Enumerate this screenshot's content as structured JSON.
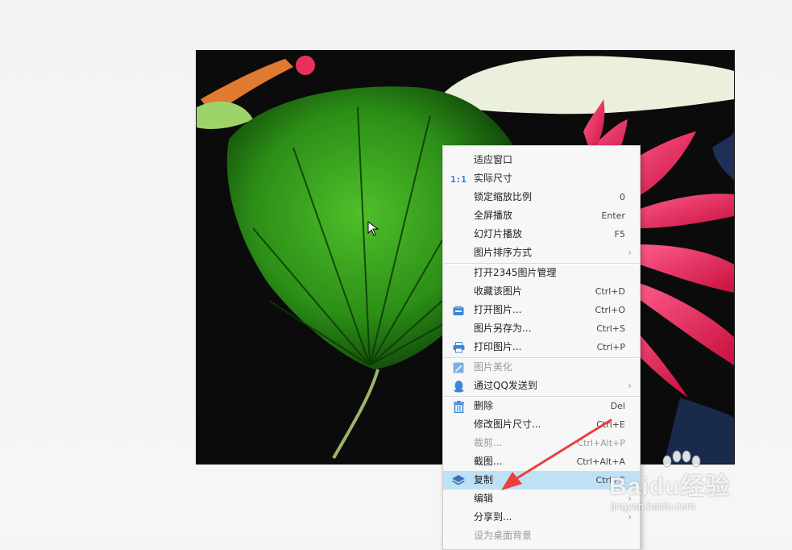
{
  "menu": {
    "items": [
      {
        "label": "适应窗口",
        "shortcut": "",
        "icon": "",
        "submenu": false,
        "disabled": false
      },
      {
        "label": "实际尺寸",
        "shortcut": "",
        "icon": "actual-size-icon",
        "icon_text": "1:1",
        "submenu": false,
        "disabled": false
      },
      {
        "label": "锁定缩放比例",
        "shortcut": "0",
        "icon": "",
        "submenu": false,
        "disabled": false
      },
      {
        "label": "全屏播放",
        "shortcut": "Enter",
        "icon": "",
        "submenu": false,
        "disabled": false
      },
      {
        "label": "幻灯片播放",
        "shortcut": "F5",
        "icon": "",
        "submenu": false,
        "disabled": false
      },
      {
        "label": "图片排序方式",
        "shortcut": "",
        "icon": "",
        "submenu": true,
        "disabled": false
      },
      {
        "label": "打开2345图片管理",
        "shortcut": "",
        "icon": "",
        "submenu": false,
        "disabled": false
      },
      {
        "label": "收藏该图片",
        "shortcut": "Ctrl+D",
        "icon": "",
        "submenu": false,
        "disabled": false
      },
      {
        "label": "打开图片...",
        "shortcut": "Ctrl+O",
        "icon": "open-image-icon",
        "submenu": false,
        "disabled": false
      },
      {
        "label": "图片另存为...",
        "shortcut": "Ctrl+S",
        "icon": "",
        "submenu": false,
        "disabled": false
      },
      {
        "label": "打印图片...",
        "shortcut": "Ctrl+P",
        "icon": "printer-icon",
        "submenu": false,
        "disabled": false
      },
      {
        "label": "图片美化",
        "shortcut": "",
        "icon": "beautify-icon",
        "submenu": false,
        "disabled": true
      },
      {
        "label": "通过QQ发送到",
        "shortcut": "",
        "icon": "qq-icon",
        "submenu": true,
        "disabled": false
      },
      {
        "label": "删除",
        "shortcut": "Del",
        "icon": "trash-icon",
        "submenu": false,
        "disabled": false
      },
      {
        "label": "修改图片尺寸...",
        "shortcut": "Ctrl+E",
        "icon": "",
        "submenu": false,
        "disabled": false
      },
      {
        "label": "裁剪...",
        "shortcut": "Ctrl+Alt+P",
        "icon": "",
        "submenu": false,
        "disabled": true
      },
      {
        "label": "截图...",
        "shortcut": "Ctrl+Alt+A",
        "icon": "",
        "submenu": false,
        "disabled": false
      },
      {
        "label": "复制",
        "shortcut": "Ctrl+C",
        "icon": "layers-icon",
        "submenu": false,
        "disabled": false,
        "highlighted": true
      },
      {
        "label": "编辑",
        "shortcut": "",
        "icon": "",
        "submenu": true,
        "disabled": false
      },
      {
        "label": "分享到...",
        "shortcut": "",
        "icon": "",
        "submenu": true,
        "disabled": false
      },
      {
        "label": "设为桌面背景",
        "shortcut": "",
        "icon": "",
        "submenu": false,
        "disabled": true
      }
    ]
  },
  "watermark": {
    "main": "Baidu经验",
    "sub": "jingyan.baidu.com"
  },
  "colors": {
    "menu_highlight": "#bfe1f6",
    "accent_blue": "#2f7fd8",
    "annotation_arrow": "#e8403a"
  }
}
